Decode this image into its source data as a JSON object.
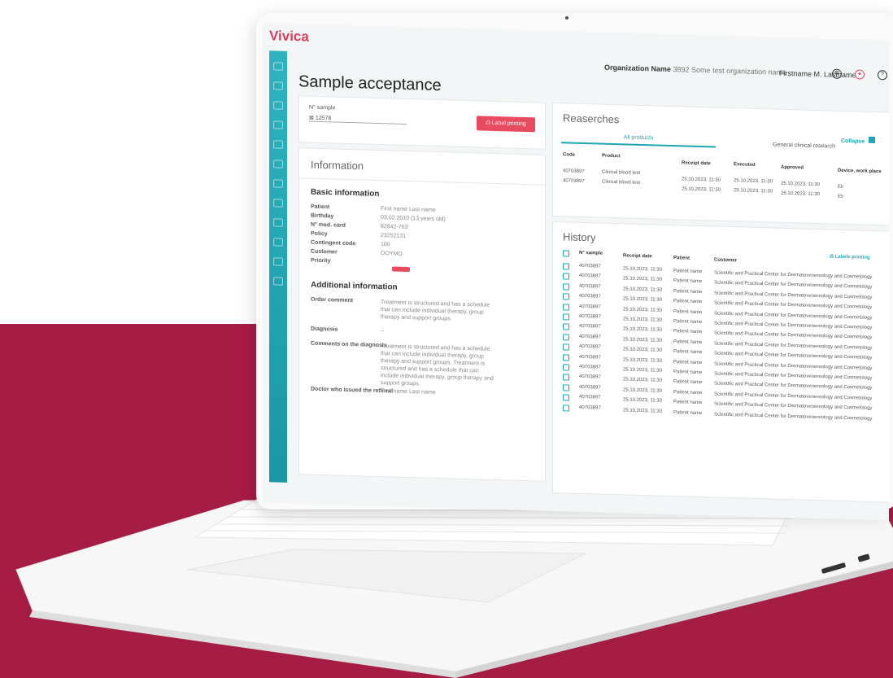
{
  "brand": "Vivica",
  "header": {
    "org_label": "Organization Name",
    "org_value": "3892 Some test organization name",
    "user": "Firstname M. Lastname"
  },
  "page_title": "Sample acceptance",
  "sample": {
    "label": "N° sample",
    "value": "12578",
    "button": "Label printing"
  },
  "information": {
    "title": "Information",
    "basic_title": "Basic information",
    "fields": [
      {
        "label": "Patient",
        "value": "First name Last name"
      },
      {
        "label": "Birthday",
        "value": "03.02.2010 (13 years old)"
      },
      {
        "label": "N° med. card",
        "value": "82842-763"
      },
      {
        "label": "Policy",
        "value": "23252131"
      },
      {
        "label": "Contingent code",
        "value": "100"
      },
      {
        "label": "Customer",
        "value": "OOYMO"
      },
      {
        "label": "Priority",
        "value": ""
      }
    ],
    "additional_title": "Additional information",
    "additional": [
      {
        "label": "Order comment",
        "value": "Treatment is structured and has a schedule that can include individual therapy, group therapy and support groups."
      },
      {
        "label": "Diagnosis",
        "value": "–"
      },
      {
        "label": "Comments on the diagnosis",
        "value": "Treatment is structured and has a schedule that can include individual therapy, group therapy and support groups. Treatment is structured and has a schedule that can include individual therapy, group therapy and support groups."
      },
      {
        "label": "Doctor who issued the referral",
        "value": "First name Last name"
      }
    ]
  },
  "researches": {
    "title": "Reaserches",
    "tabs": [
      "All products",
      "General clinical research"
    ],
    "collapse": "Collapse",
    "columns": [
      "Code",
      "Product",
      "Receipt date",
      "Executed",
      "Approved",
      "Device, work place"
    ],
    "rows": [
      [
        "40703897",
        "Clinical blood test",
        "25.10.2023, 11:30",
        "25.10.2023, 11:30",
        "25.10.2023, 11:30",
        "Elr"
      ],
      [
        "40703897",
        "Clinical blood test",
        "25.10.2023, 11:30",
        "25.10.2023, 11:30",
        "25.10.2023, 11:30",
        "Elr"
      ]
    ]
  },
  "history": {
    "title": "History",
    "button": "Labels printing",
    "columns": [
      "N° sample",
      "Receipt date",
      "Patient",
      "Customer"
    ],
    "rows": [
      [
        "40703897",
        "25.10.2023, 11:30",
        "Patient name",
        "Scientific and Practical Center for Dermatovenereology and Cosmetology"
      ],
      [
        "40703897",
        "25.10.2023, 11:30",
        "Patient name",
        "Scientific and Practical Center for Dermatovenereology and Cosmetology"
      ],
      [
        "40703897",
        "25.10.2023, 11:30",
        "Patient name",
        "Scientific and Practical Center for Dermatovenereology and Cosmetology"
      ],
      [
        "40703897",
        "25.10.2023, 11:30",
        "Patient name",
        "Scientific and Practical Center for Dermatovenereology and Cosmetology"
      ],
      [
        "40703897",
        "25.10.2023, 11:30",
        "Patient name",
        "Scientific and Practical Center for Dermatovenereology and Cosmetology"
      ],
      [
        "40703897",
        "25.10.2023, 11:30",
        "Patient name",
        "Scientific and Practical Center for Dermatovenereology and Cosmetology"
      ],
      [
        "40703897",
        "25.10.2023, 11:30",
        "Patient name",
        "Scientific and Practical Center for Dermatovenereology and Cosmetology"
      ],
      [
        "40703897",
        "25.10.2023, 11:30",
        "Patient name",
        "Scientific and Practical Center for Dermatovenereology and Cosmetology"
      ],
      [
        "40703897",
        "25.10.2023, 11:30",
        "Patient name",
        "Scientific and Practical Center for Dermatovenereology and Cosmetology"
      ],
      [
        "40703897",
        "25.10.2023, 11:30",
        "Patient name",
        "Scientific and Practical Center for Dermatovenereology and Cosmetology"
      ],
      [
        "40703897",
        "25.10.2023, 11:30",
        "Patient name",
        "Scientific and Practical Center for Dermatovenereology and Cosmetology"
      ],
      [
        "40703897",
        "25.10.2023, 11:30",
        "Patient name",
        "Scientific and Practical Center for Dermatovenereology and Cosmetology"
      ],
      [
        "40703897",
        "25.10.2023, 11:30",
        "Patient name",
        "Scientific and Practical Center for Dermatovenereology and Cosmetology"
      ],
      [
        "40703897",
        "25.10.2023, 11:30",
        "Patient name",
        "Scientific and Practical Center for Dermatovenereology and Cosmetology"
      ],
      [
        "40703897",
        "25.10.2023, 11:30",
        "Patient name",
        "Scientific and Practical Center for Dermatovenereology and Cosmetology"
      ]
    ]
  }
}
